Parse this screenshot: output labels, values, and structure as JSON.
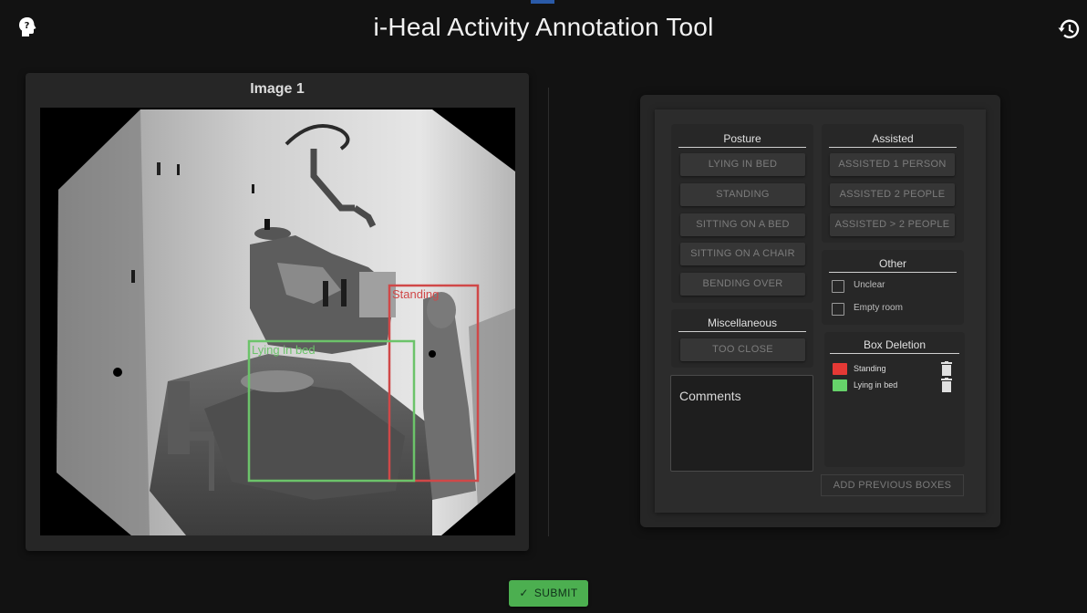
{
  "header": {
    "title": "i-Heal Activity Annotation Tool"
  },
  "image_panel": {
    "title": "Image 1",
    "annotations": [
      {
        "label": "Standing",
        "color": "#d04848"
      },
      {
        "label": "Lying in bed",
        "color": "#6cc36a"
      }
    ]
  },
  "posture": {
    "title": "Posture",
    "buttons": [
      "LYING IN BED",
      "STANDING",
      "SITTING ON A BED",
      "SITTING ON A CHAIR",
      "BENDING OVER"
    ]
  },
  "miscellaneous": {
    "title": "Miscellaneous",
    "buttons": [
      "TOO CLOSE"
    ]
  },
  "assisted": {
    "title": "Assisted",
    "buttons": [
      "ASSISTED 1 PERSON",
      "ASSISTED 2 PEOPLE",
      "ASSISTED > 2 PEOPLE"
    ]
  },
  "other": {
    "title": "Other",
    "options": [
      {
        "label": "Unclear",
        "checked": false
      },
      {
        "label": "Empty room",
        "checked": false
      }
    ]
  },
  "comments": {
    "label": "Comments"
  },
  "box_deletion": {
    "title": "Box Deletion",
    "boxes": [
      {
        "label": "Standing",
        "color": "#e53935"
      },
      {
        "label": "Lying in bed",
        "color": "#66d26a"
      }
    ]
  },
  "add_previous_label": "ADD PREVIOUS BOXES",
  "submit_label": "SUBMIT",
  "colors": {
    "accent_green": "#4caf50",
    "background": "#121212"
  },
  "icons": {
    "left": "help-head-icon",
    "right": "history-icon"
  }
}
